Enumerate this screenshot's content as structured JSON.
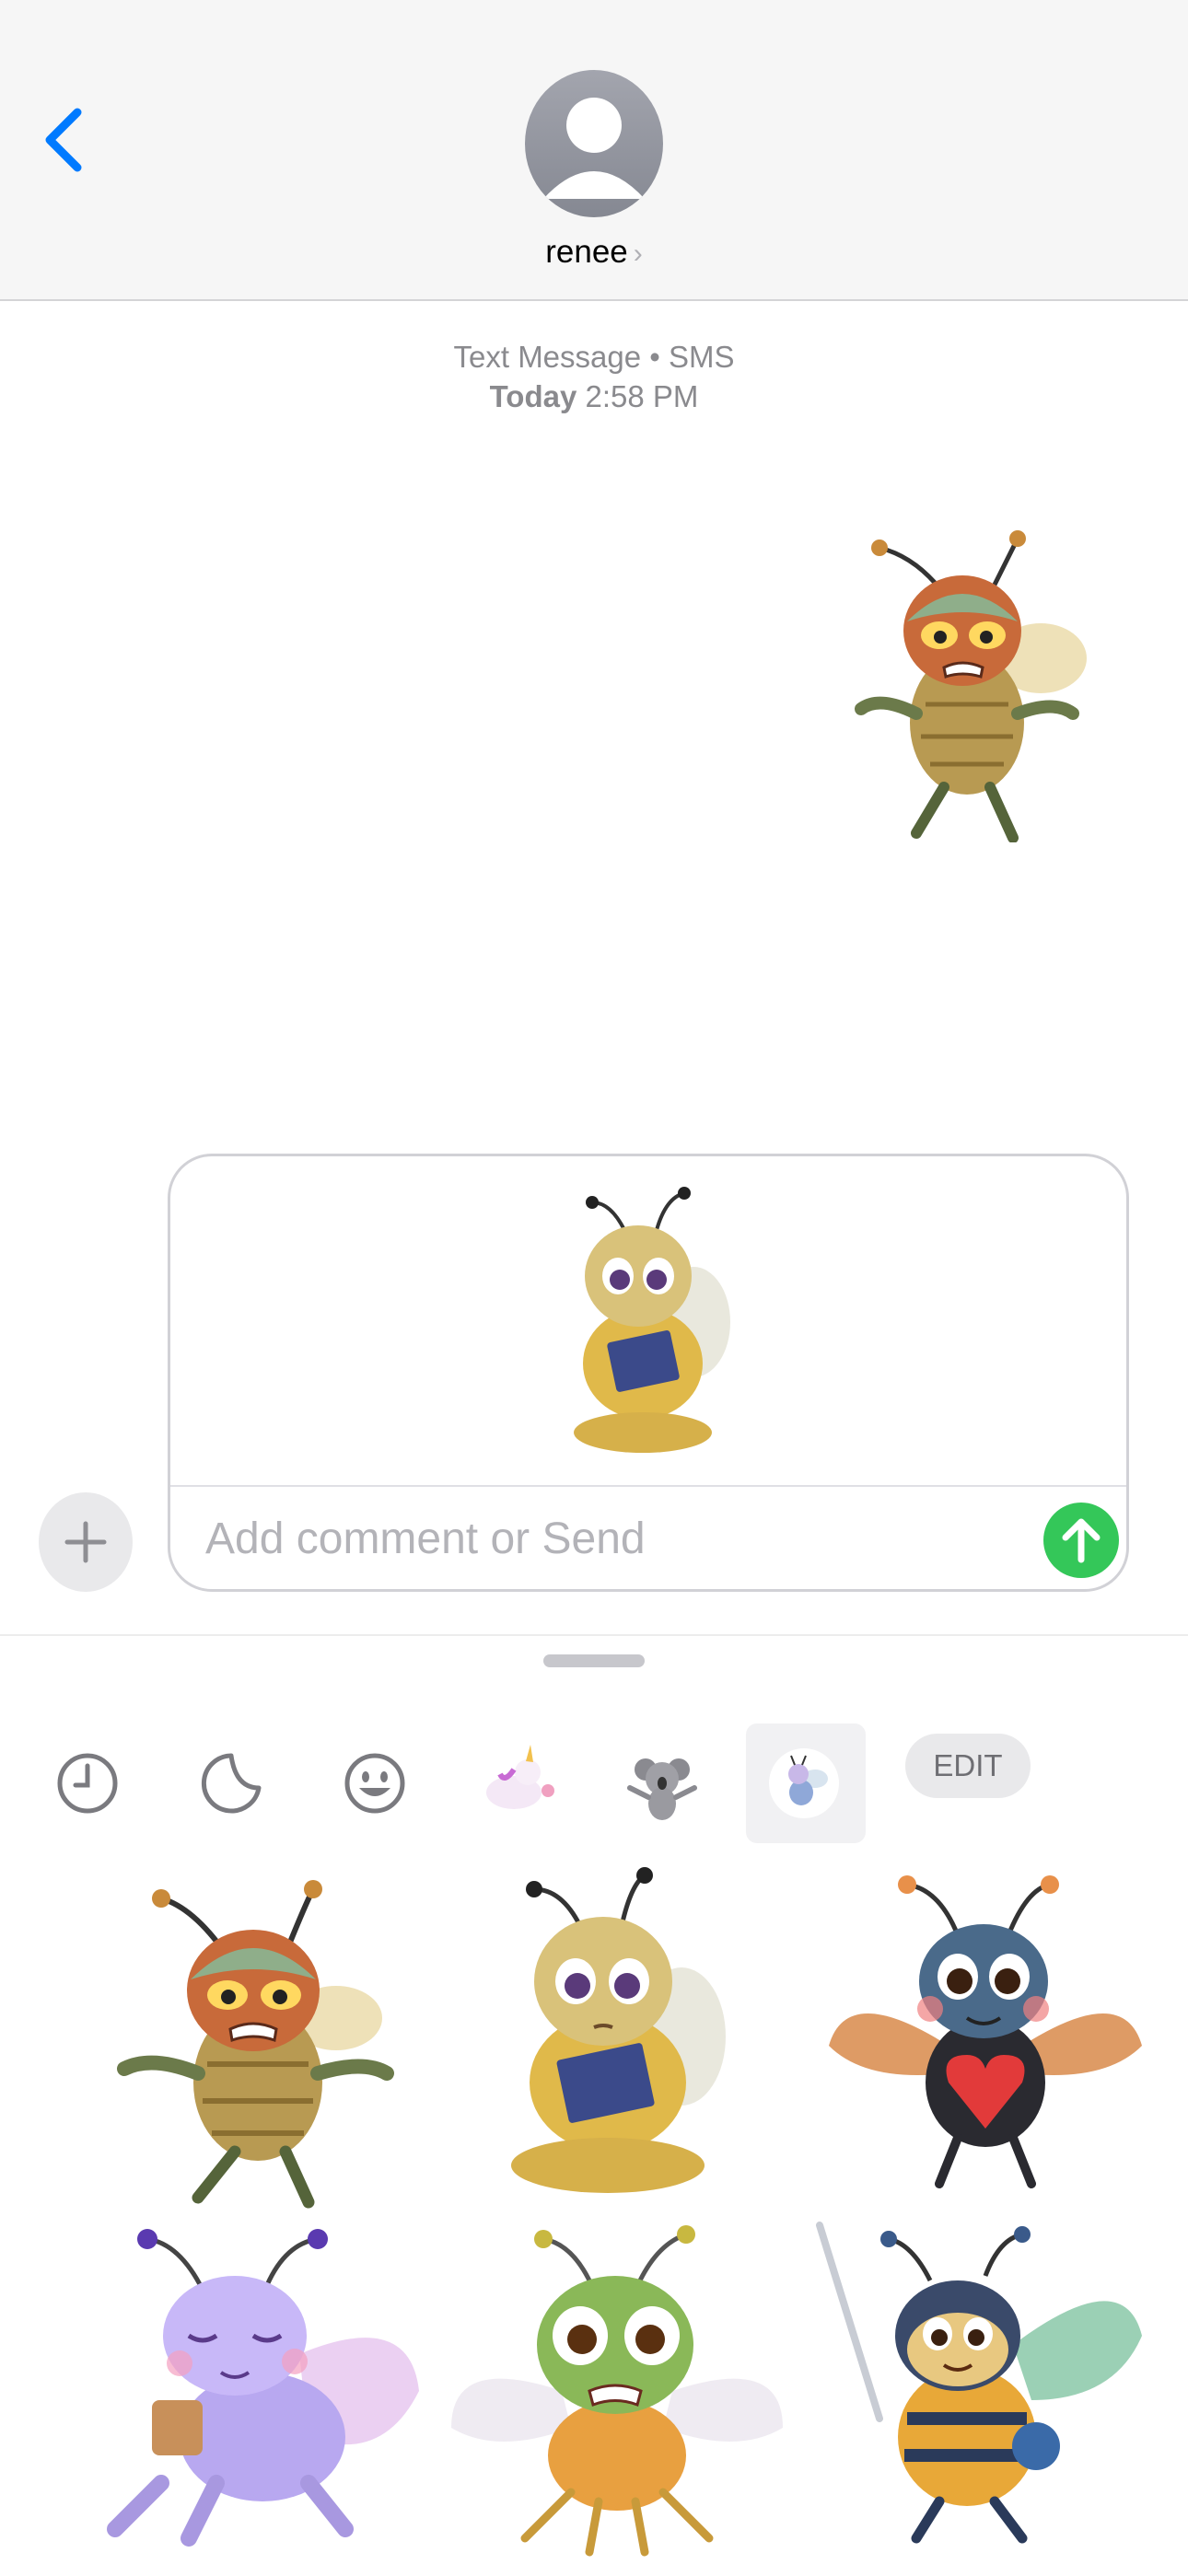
{
  "header": {
    "back_icon": "chevron-left-icon",
    "contact_name": "renee",
    "chevron": "›"
  },
  "conversation": {
    "service": "Text Message • SMS",
    "day": "Today",
    "time": "2:58 PM",
    "sent_sticker": "angry-bee-sticker"
  },
  "compose": {
    "attached_sticker": "reading-bee-sticker",
    "placeholder": "Add comment or Send",
    "send_icon": "arrow-up-icon",
    "plus_icon": "plus-icon"
  },
  "drawer": {
    "tabs": [
      {
        "name": "recents",
        "icon": "clock-icon"
      },
      {
        "name": "stickers",
        "icon": "peel-sticker-icon"
      },
      {
        "name": "emoji",
        "icon": "smiley-icon"
      },
      {
        "name": "unicorn-pack",
        "icon": "unicorn-sticker-icon"
      },
      {
        "name": "koala-pack",
        "icon": "koala-sticker-icon"
      },
      {
        "name": "bee-pack",
        "icon": "bee-sticker-icon",
        "selected": true
      }
    ],
    "edit_label": "EDIT",
    "stickers": [
      "angry-bee-sticker",
      "reading-bee-sticker",
      "heart-bug-sticker",
      "coffee-bug-sticker",
      "worried-fly-sticker",
      "sword-bee-sticker"
    ]
  },
  "colors": {
    "accent": "#007aff",
    "send": "#34c759",
    "meta_text": "#8a8a8e"
  }
}
